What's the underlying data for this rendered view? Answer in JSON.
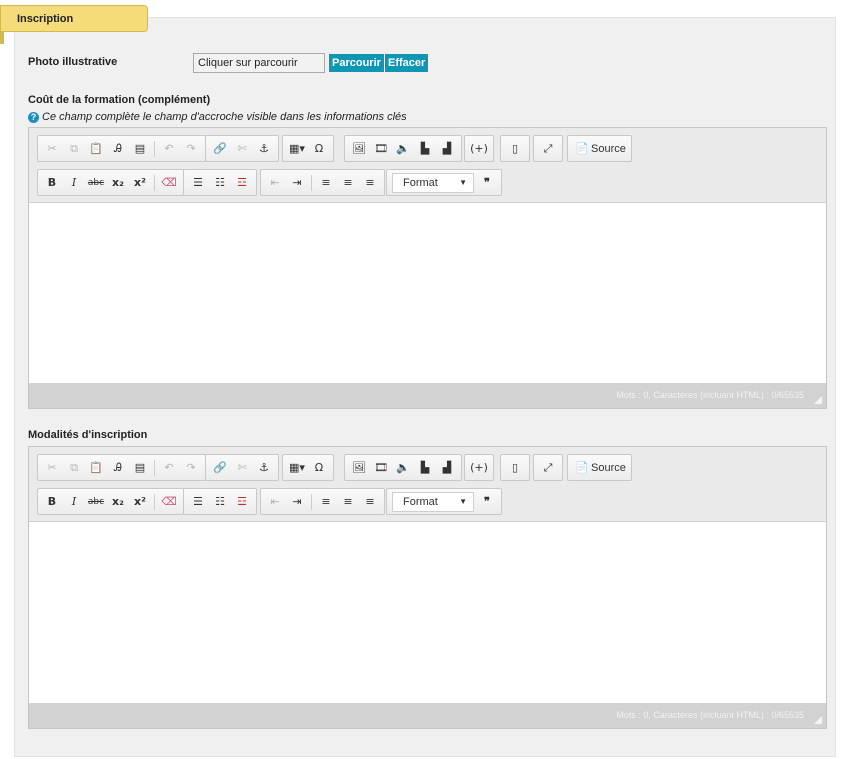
{
  "tab": {
    "label": "Inscription"
  },
  "photo": {
    "label": "Photo illustrative",
    "input_value": "Cliquer sur parcourir",
    "browse_label": "Parcourir",
    "clear_label": "Effacer"
  },
  "cout": {
    "label": "Coût de la formation (complément)",
    "hint": "Ce champ complète le champ d'accroche visible dans les informations clés",
    "hint_icon": "?"
  },
  "modalites": {
    "label": "Modalités d'inscription"
  },
  "editor": {
    "source_label": "Source",
    "format_label": "Format",
    "status": "Mots : 0, Caractères (incluant HTML) : 0/65535",
    "toolbar_row1_icons": [
      "cut-icon",
      "copy-icon",
      "paste-icon",
      "paste-text-icon",
      "paste-word-icon",
      "undo-icon",
      "redo-icon",
      "link-icon",
      "unlink-icon",
      "anchor-icon",
      "table-icon",
      "special-char-icon",
      "image-icon",
      "video-icon",
      "audio-icon",
      "chart-icon",
      "chart-alt-icon",
      "placeholder-icon",
      "template-icon",
      "maximize-icon",
      "source-icon"
    ],
    "toolbar_row2_icons": [
      "bold-icon",
      "italic-icon",
      "strike-icon",
      "subscript-icon",
      "superscript-icon",
      "remove-format-icon",
      "numbered-list-icon",
      "bulleted-list-icon",
      "clear-list-icon",
      "outdent-icon",
      "indent-icon",
      "align-left-icon",
      "align-center-icon",
      "align-right-icon",
      "blockquote-icon"
    ]
  },
  "colors": {
    "accent_tab": "#f5dc7a",
    "button_blue": "#0e96b4",
    "statusbar": "#d2d2d2"
  }
}
